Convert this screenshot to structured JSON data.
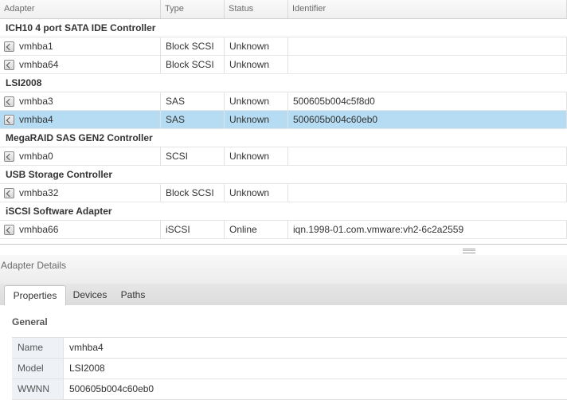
{
  "table": {
    "headers": [
      "Adapter",
      "Type",
      "Status",
      "Identifier"
    ],
    "groups": [
      {
        "name": "ICH10 4 port SATA IDE Controller",
        "rows": [
          {
            "adapter": "vmhba1",
            "type": "Block SCSI",
            "status": "Unknown",
            "identifier": ""
          },
          {
            "adapter": "vmhba64",
            "type": "Block SCSI",
            "status": "Unknown",
            "identifier": ""
          }
        ]
      },
      {
        "name": "LSI2008",
        "rows": [
          {
            "adapter": "vmhba3",
            "type": "SAS",
            "status": "Unknown",
            "identifier": "500605b004c5f8d0"
          },
          {
            "adapter": "vmhba4",
            "type": "SAS",
            "status": "Unknown",
            "identifier": "500605b004c60eb0",
            "selected": true
          }
        ]
      },
      {
        "name": "MegaRAID SAS GEN2 Controller",
        "rows": [
          {
            "adapter": "vmhba0",
            "type": "SCSI",
            "status": "Unknown",
            "identifier": ""
          }
        ]
      },
      {
        "name": "USB Storage Controller",
        "rows": [
          {
            "adapter": "vmhba32",
            "type": "Block SCSI",
            "status": "Unknown",
            "identifier": ""
          }
        ]
      },
      {
        "name": "iSCSI Software Adapter",
        "rows": [
          {
            "adapter": "vmhba66",
            "type": "iSCSI",
            "status": "Online",
            "identifier": "iqn.1998-01.com.vmware:vh2-6c2a2559"
          }
        ]
      }
    ]
  },
  "details": {
    "title": "Adapter Details",
    "tabs": [
      "Properties",
      "Devices",
      "Paths"
    ],
    "active_tab": "Properties",
    "section": "General",
    "properties": [
      {
        "key": "Name",
        "value": "vmhba4"
      },
      {
        "key": "Model",
        "value": "LSI2008"
      },
      {
        "key": "WWNN",
        "value": "500605b004c60eb0"
      }
    ]
  },
  "icons": {
    "adapter_row_icon": "storage-adapter-icon",
    "splitter": "splitter-grip-icon"
  },
  "colors": {
    "selected_row": "#b5dcf2",
    "property_key_bg": "#eef1f6"
  }
}
